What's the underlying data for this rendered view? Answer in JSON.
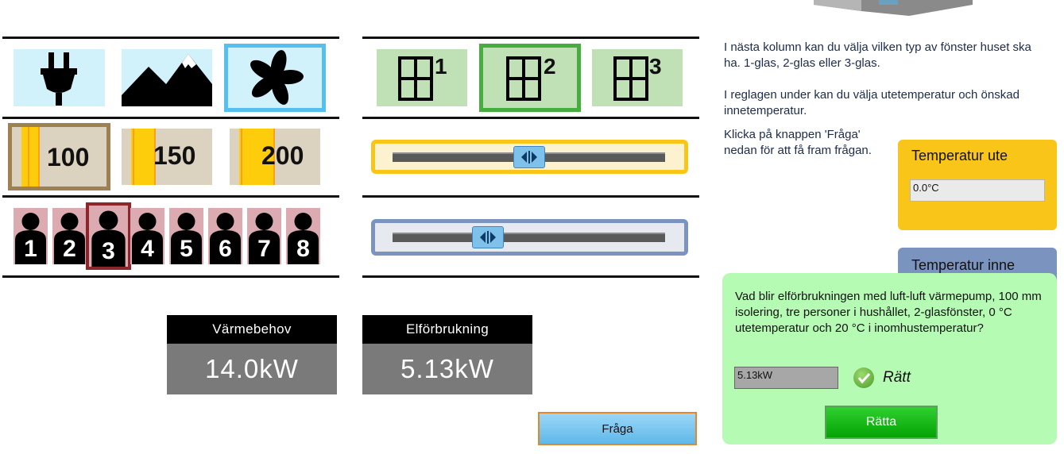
{
  "heating": {
    "options": [
      {
        "icon": "plug-icon",
        "selected": false
      },
      {
        "icon": "mountain-icon",
        "selected": false
      },
      {
        "icon": "fan-icon",
        "selected": true
      }
    ]
  },
  "windows": {
    "options": [
      {
        "label": "1",
        "selected": false
      },
      {
        "label": "2",
        "selected": true
      },
      {
        "label": "3",
        "selected": false
      }
    ]
  },
  "insulation": {
    "options": [
      {
        "label": "100",
        "selected": true
      },
      {
        "label": "150",
        "selected": false
      },
      {
        "label": "200",
        "selected": false
      }
    ]
  },
  "persons": {
    "options": [
      {
        "label": "1"
      },
      {
        "label": "2"
      },
      {
        "label": "3"
      },
      {
        "label": "4"
      },
      {
        "label": "5"
      },
      {
        "label": "6"
      },
      {
        "label": "7"
      },
      {
        "label": "8"
      }
    ],
    "selected": "3"
  },
  "sliders": {
    "outdoor_position": 0.5,
    "indoor_position": 0.33
  },
  "readouts": {
    "heat_label": "Värmebehov",
    "heat_value": "14.0kW",
    "power_label": "Elförbrukning",
    "power_value": "5.13kW"
  },
  "buttons": {
    "ask": "Fråga",
    "check": "Rätta"
  },
  "info": {
    "p1": "I nästa kolumn kan du välja vilken typ av fönster huset ska ha. 1-glas, 2-glas eller 3-glas.",
    "p2": "I reglagen under kan du välja utetemperatur och önskad innetemperatur.",
    "p3": "Klicka på knappen 'Fråga' nedan för att få fram frågan."
  },
  "temperature": {
    "outdoor_title": "Temperatur ute",
    "outdoor_value": "0.0°C",
    "indoor_title": "Temperatur inne"
  },
  "question": {
    "text": "Vad blir elförbrukningen med luft-luft värmepump, 100 mm isolering, tre personer i hushållet, 2-glasfönster, 0 °C utetemperatur och 20 °C i inomhustemperatur?",
    "answer": "5.13kW",
    "status": "Rätt"
  },
  "colors": {
    "outdoor_slider": "#f9c519",
    "indoor_slider": "#7a94bf",
    "question_bg": "#b6fbb4"
  }
}
